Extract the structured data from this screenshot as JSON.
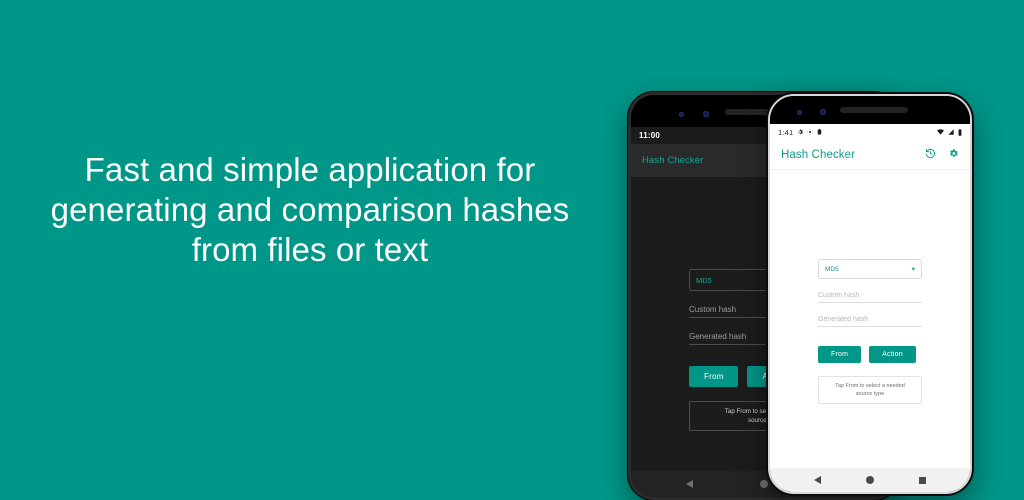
{
  "background_color": "#009688",
  "accent_color": "#009688",
  "headline": {
    "line1": "Fast and simple application for",
    "line2": "generating and comparison hashes",
    "line3": "from files or text"
  },
  "phones": {
    "dark": {
      "theme": "dark",
      "status_bar": {
        "time": "11:00"
      },
      "app_bar": {
        "title": "Hash Checker"
      },
      "form": {
        "algorithm_value": "MD5",
        "caret": "▾",
        "custom_hash_placeholder": "Custom hash",
        "generated_hash_placeholder": "Generated hash",
        "from_button": "From",
        "action_button": "Action",
        "hint_line1": "Tap From to select a needed",
        "hint_line2": "source type"
      },
      "nav_bar": {
        "back": "back-icon",
        "home": "home-icon"
      }
    },
    "light": {
      "theme": "light",
      "status_bar": {
        "time": "1:41",
        "left_icons": [
          "gear-icon",
          "gear-icon",
          "clipboard-icon"
        ],
        "right_icons": [
          "wifi-icon",
          "signal-icon",
          "battery-icon"
        ]
      },
      "app_bar": {
        "title": "Hash Checker",
        "history_icon": "history-icon",
        "settings_icon": "gear-icon"
      },
      "form": {
        "algorithm_value": "MD5",
        "caret": "▾",
        "custom_hash_placeholder": "Custom hash",
        "generated_hash_placeholder": "Generated hash",
        "from_button": "From",
        "action_button": "Action",
        "hint_line1": "Tap From to select a needed",
        "hint_line2": "source type"
      },
      "nav_bar": {
        "back": "back-icon",
        "home": "home-icon",
        "recents": "recents-icon"
      }
    }
  }
}
